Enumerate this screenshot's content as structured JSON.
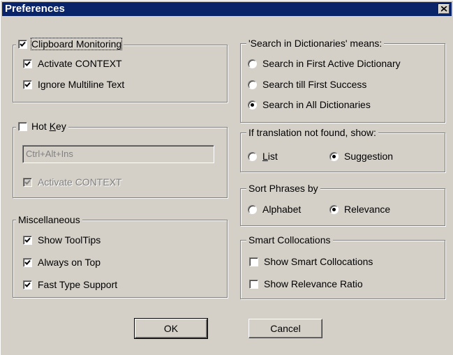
{
  "window": {
    "title": "Preferences"
  },
  "clipboard_group": {
    "items": [
      {
        "label": "Clipboard Monitoring",
        "checked": true
      },
      {
        "label": "Activate CONTEXT",
        "checked": true
      },
      {
        "label": "Ignore Multiline Text",
        "checked": true
      }
    ]
  },
  "hotkey_group": {
    "label": "Hot Key",
    "checked": false,
    "value": "Ctrl+Alt+Ins",
    "activate_label": "Activate CONTEXT",
    "activate_checked": true
  },
  "misc_group": {
    "title": "Miscellaneous",
    "items": [
      {
        "label": "Show ToolTips",
        "checked": true
      },
      {
        "label": "Always on Top",
        "checked": true
      },
      {
        "label": "Fast Type Support",
        "checked": true
      }
    ]
  },
  "search_group": {
    "title": "'Search in Dictionaries' means:",
    "options": [
      {
        "label": "Search in First Active Dictionary",
        "selected": false
      },
      {
        "label": "Search till First Success",
        "selected": false
      },
      {
        "label": "Search in All Dictionaries",
        "selected": true
      }
    ]
  },
  "notfound_group": {
    "title": "If translation not found, show:",
    "options": [
      {
        "label": "List",
        "selected": false
      },
      {
        "label": "Suggestion",
        "selected": true
      }
    ]
  },
  "sort_group": {
    "title": "Sort Phrases by",
    "options": [
      {
        "label": "Alphabet",
        "selected": false
      },
      {
        "label": "Relevance",
        "selected": true
      }
    ]
  },
  "smart_group": {
    "title": "Smart Collocations",
    "items": [
      {
        "label": "Show Smart Collocations",
        "checked": false
      },
      {
        "label": "Show Relevance Ratio",
        "checked": false
      }
    ]
  },
  "buttons": {
    "ok": "OK",
    "cancel": "Cancel"
  }
}
